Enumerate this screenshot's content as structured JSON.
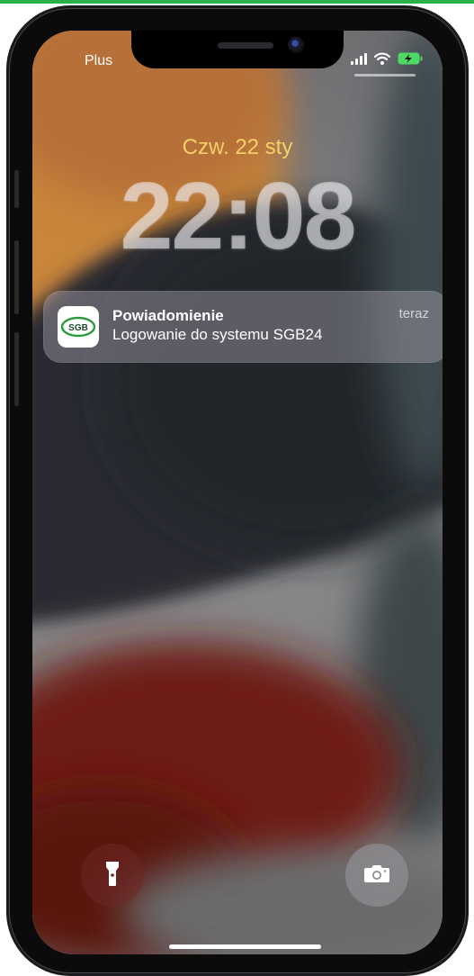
{
  "status_bar": {
    "carrier": "Plus",
    "icons": [
      "signal-icon",
      "wifi-icon",
      "battery-charging-icon"
    ]
  },
  "lock_screen": {
    "date": "Czw. 22 sty",
    "time": "22:08"
  },
  "notification": {
    "app_icon_text": "SGB",
    "title": "Powiadomienie",
    "body": "Logowanie do systemu SGB24",
    "time": "teraz"
  },
  "quick_actions": {
    "left": "flashlight-icon",
    "right": "camera-icon"
  },
  "colors": {
    "date_color": "#f3d06a",
    "frame_accent": "#2bb24c",
    "battery": "#4cd964",
    "sgb_green": "#2e9a3e"
  }
}
